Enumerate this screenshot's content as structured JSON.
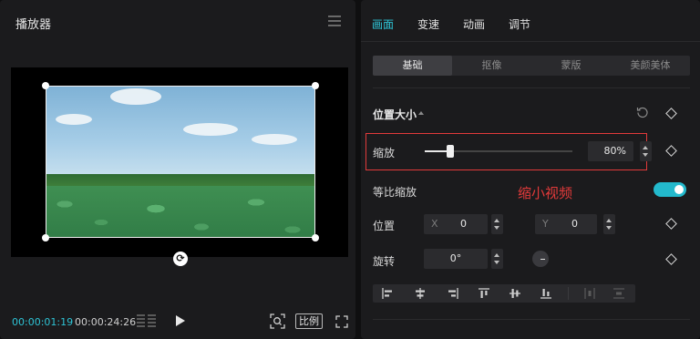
{
  "player": {
    "title": "播放器",
    "time_current": "00:00:01:19",
    "time_total": "00:00:24:26",
    "ratio_label": "比例"
  },
  "tabs": [
    "画面",
    "变速",
    "动画",
    "调节"
  ],
  "active_tab": "画面",
  "subtabs": [
    "基础",
    "抠像",
    "蒙版",
    "美颜美体"
  ],
  "active_subtab": "基础",
  "section_title": "位置大小",
  "scale": {
    "label": "缩放",
    "value": "80%",
    "level": 0.17
  },
  "annotation": "缩小视频",
  "uniform_scale": {
    "label": "等比缩放",
    "enabled": true
  },
  "position": {
    "label": "位置",
    "x_label": "X",
    "x_value": "0",
    "y_label": "Y",
    "y_value": "0"
  },
  "rotation": {
    "label": "旋转",
    "value": "0°"
  },
  "colors": {
    "accent": "#2ec4d6",
    "highlight": "#e23a3a",
    "panel": "#1b1b1d"
  },
  "icons": {
    "align": [
      "align-left-icon",
      "align-center-h-icon",
      "align-right-icon",
      "align-top-icon",
      "align-center-v-icon",
      "align-bottom-icon",
      "distribute-h-icon",
      "distribute-v-icon"
    ]
  }
}
